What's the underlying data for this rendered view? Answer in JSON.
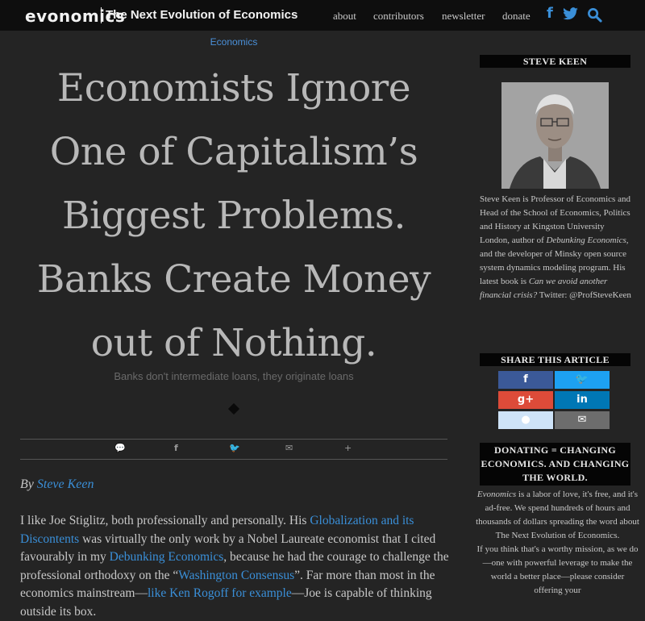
{
  "header": {
    "logo": "evonomics",
    "tagline": "The Next Evolution of Economics",
    "nav": [
      "about",
      "contributors",
      "newsletter",
      "donate"
    ],
    "social_icons": [
      "facebook-icon",
      "twitter-icon",
      "search-icon"
    ]
  },
  "article": {
    "category": "Economics",
    "title": "Economists Ignore One of Capitalism’s Biggest Problems. Banks Create Money out of Nothing.",
    "subtitle": "Banks don't intermediate loans, they originate loans",
    "byline_prefix": "By",
    "author": "Steve Keen",
    "body": {
      "t1": "I like Joe Stiglitz, both professionally and personally. His ",
      "l1": "Globalization and its Discontents",
      "t2": " was virtually the only work by a Nobel Laureate economist that I cited favourably in my ",
      "l2": "Debunking Economics",
      "t3": ", because he had the courage to challenge the professional orthodoxy on the “",
      "l3": "Washington Consensus",
      "t4": "”. Far more than most in the economics mainstream—",
      "l4": "like Ken Rogoff for example",
      "t5": "—Joe is capable of thinking outside its box."
    }
  },
  "sidebar": {
    "author_heading": "STEVE KEEN",
    "bio": {
      "p1": "Steve Keen is Professor of Economics and Head of the School of Economics, Politics and History at Kingston University London, author of ",
      "book1": "Debunking Economics",
      "p2": ", and the developer of Minsky open source system dynamics modeling program. His latest book is ",
      "book2": "Can we avoid another financial crisis?",
      "p3": " Twitter: @ProfSteveKeen"
    },
    "share_heading": "SHARE THIS ARTICLE",
    "share_buttons": [
      {
        "icon": "facebook-icon",
        "glyph": "f",
        "color": "#3b5998"
      },
      {
        "icon": "twitter-icon",
        "glyph": "🐦",
        "color": "#1da1f2"
      },
      {
        "icon": "google-plus-icon",
        "glyph": "g+",
        "color": "#dd4b39"
      },
      {
        "icon": "linkedin-icon",
        "glyph": "in",
        "color": "#0077b5"
      },
      {
        "icon": "reddit-icon",
        "glyph": "●",
        "color": "#cee3f8"
      },
      {
        "icon": "email-icon",
        "glyph": "✉",
        "color": "#6d6d6d"
      }
    ],
    "donate_heading": "DONATING = CHANGING ECONOMICS. AND CHANGING THE WORLD.",
    "donate": {
      "brand": "Evonomics",
      "p1": " is a labor of love, it's free, and it's ad-free. We spend hundreds of hours and thousands of dollars spreading the word about The Next Evolution of Economics.",
      "p2": "If you think that's a worthy mission, as we do—one with powerful leverage to make the world a better place—please consider offering your"
    }
  }
}
